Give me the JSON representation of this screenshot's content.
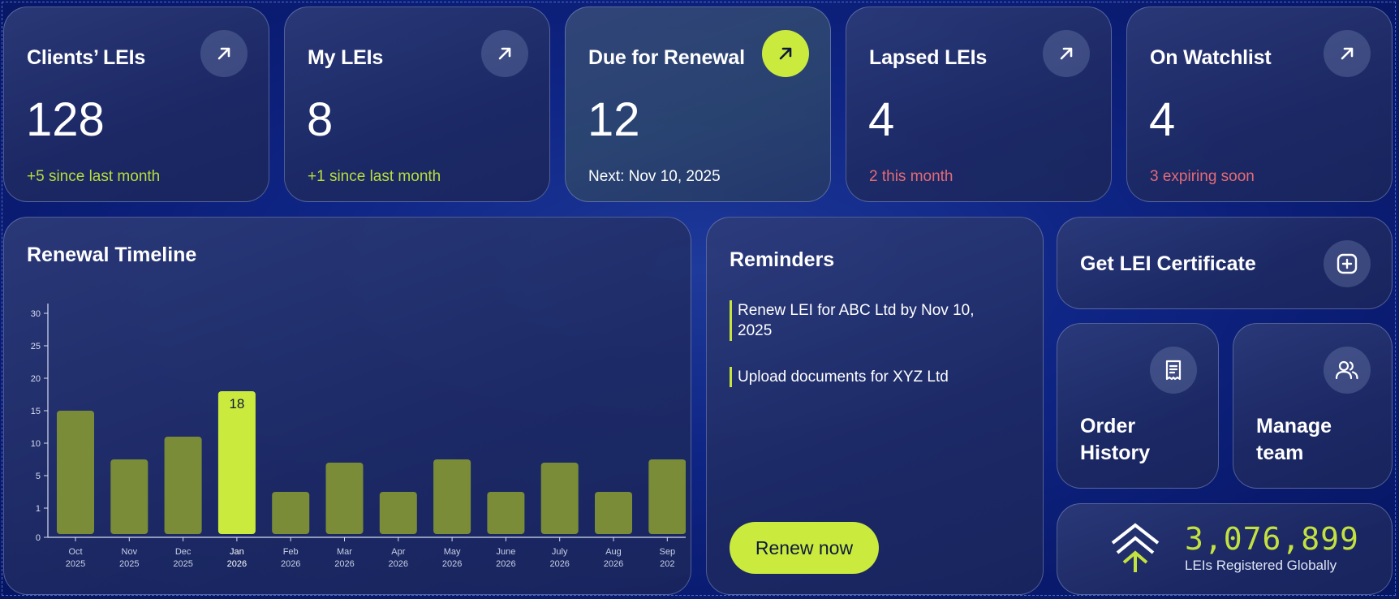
{
  "stats": [
    {
      "title": "Clients’ LEIs",
      "value": "128",
      "sub": "+5 since last month",
      "tone": "green"
    },
    {
      "title": "My LEIs",
      "value": "8",
      "sub": "+1 since last month",
      "tone": "green"
    },
    {
      "title": "Due for Renewal",
      "value": "12",
      "sub": "Next: Nov 10, 2025",
      "tone": "white"
    },
    {
      "title": "Lapsed LEIs",
      "value": "4",
      "sub": "2 this month",
      "tone": "red"
    },
    {
      "title": "On Watchlist",
      "value": "4",
      "sub": "3 expiring soon",
      "tone": "red"
    }
  ],
  "timeline": {
    "title": "Renewal Timeline"
  },
  "chart_data": {
    "type": "bar",
    "title": "Renewal Timeline",
    "categories": [
      [
        "Oct",
        "2025"
      ],
      [
        "Nov",
        "2025"
      ],
      [
        "Dec",
        "2025"
      ],
      [
        "Jan",
        "2026"
      ],
      [
        "Feb",
        "2026"
      ],
      [
        "Mar",
        "2026"
      ],
      [
        "Apr",
        "2026"
      ],
      [
        "May",
        "2026"
      ],
      [
        "June",
        "2026"
      ],
      [
        "July",
        "2026"
      ],
      [
        "Aug",
        "2026"
      ],
      [
        "Sep",
        "202"
      ]
    ],
    "values": [
      15,
      7.5,
      11,
      18,
      3,
      7,
      3,
      7.5,
      3,
      7,
      3,
      7.5
    ],
    "highlight_index": 3,
    "highlight_label": "18",
    "y_ticks": [
      "0",
      "1",
      "5",
      "10",
      "15",
      "20",
      "25",
      "30"
    ],
    "ylim": [
      0,
      30
    ],
    "colors": {
      "bar": "#7a8c37",
      "highlight": "#cbea3e"
    }
  },
  "reminders": {
    "title": "Reminders",
    "items": [
      "Renew LEI for ABC Ltd by Nov 10, 2025",
      "Upload documents for XYZ Ltd"
    ],
    "button": "Renew now"
  },
  "actions": {
    "get_certificate": "Get LEI Certificate",
    "order_history": [
      "Order",
      "History"
    ],
    "manage_team": [
      "Manage",
      "team"
    ]
  },
  "global": {
    "count": "3,076,899",
    "label": "LEIs Registered Globally"
  },
  "icons": {
    "arrow": "arrow-up-right-icon",
    "plus": "plus-square-icon",
    "receipt": "receipt-icon",
    "users": "users-icon",
    "logo": "chevron-up-logo-icon"
  },
  "colors": {
    "accent": "#cbea3e",
    "positive": "#b9dd3c",
    "negative": "#e36b76"
  }
}
